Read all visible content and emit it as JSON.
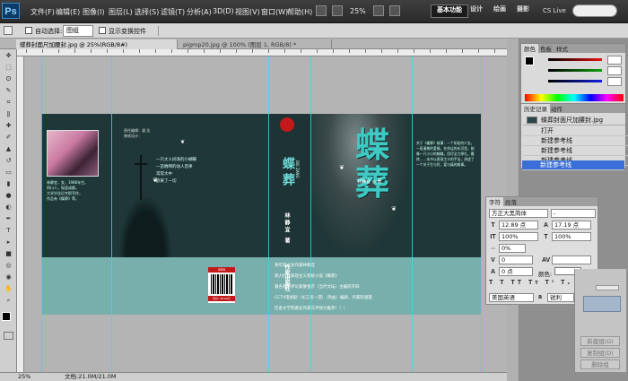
{
  "menubar": {
    "logo": "Ps",
    "items": [
      "文件(F)",
      "编辑(E)",
      "图像(I)",
      "图层(L)",
      "选择(S)",
      "滤镜(T)",
      "分析(A)",
      "3D(D)",
      "视图(V)",
      "窗口(W)",
      "帮助(H)"
    ],
    "zoom": "25%",
    "workspaces": [
      "基本功能",
      "设计",
      "绘画",
      "摄影"
    ],
    "cs_live": "CS Live"
  },
  "options_bar": {
    "auto_select_label": "自动选择:",
    "auto_select_value": "图组",
    "show_transform_label": "显示变换控件"
  },
  "tabs": [
    {
      "label": "蝶葬封面尺加腰封.jpg @ 25%(RGB/8#)",
      "active": true
    },
    {
      "label": "pigmp20.jpg @ 100% (图层 1, RGB/8) *",
      "active": false
    }
  ],
  "statusbar": {
    "zoom": "25%",
    "doc_info": "文档:21.0M/21.0M"
  },
  "cover": {
    "title_big": "蝶葬",
    "title_pinyin": "DIE ZANG",
    "back_top_text": "责任编辑：潘 浩\n装帧设计：",
    "back_author_label": "林静宜",
    "poem": "一只大人间泽的小蝴蝶\n一首缠绵的动人音律\n常常大中\n欲来了一切",
    "spine_author": "林静宜 著",
    "spine_publisher": "作家出版社",
    "front_author_tag": "林静宜 ◎ 著",
    "front_slogan": "青年鬼才女作家林静宜\n耗力打造表现主义系统小说《蝶葬》\n著名视剧评论家廖金京（当代文坛）主编何开四\nCCTV电视剧（长江第一漂）（热血）编剧，作家陈祖殷\n巴金文学院著名作家马平倾力推荐！！！",
    "barcode_label": "ISBN",
    "barcode_price": "定价: 28.00元",
    "back_flap_lines": "林静宜，女，1986年生。\n四川人，现居成都。\n大学毕业后专职写作，\n作品有《蝶葬》等。",
    "front_flap_text": "关于《蝶葬》故事：一个如花的少女，一段凄美的爱情。在命运的长河里，她像一只小小的蝴蝶，用尽全力挣扎，最终……本书以表现主义的手法，讲述了一个关于生与死、爱与痛的故事。"
  },
  "color_panel": {
    "tabs": [
      "颜色",
      "色板",
      "样式"
    ],
    "slider_colors": [
      "#e81010",
      "#10a010",
      "#1020e0"
    ]
  },
  "history_panel": {
    "tabs": [
      "历史记录",
      "动作"
    ],
    "snapshot": "蝶葬封面尺加腰封.jpg",
    "items": [
      "打开",
      "新建参考线",
      "新建参考线",
      "新建参考线",
      "新建参考线"
    ],
    "selected_index": 4
  },
  "char_panel": {
    "tabs": [
      "字符",
      "段落"
    ],
    "font": "方正大黑简体",
    "style": "-",
    "size": "12.89 点",
    "leading": "17.19 点",
    "vscale": "100%",
    "hscale": "100%",
    "tracking": "0%",
    "kerning": "0",
    "baseline": "0 点",
    "color_label": "颜色:",
    "language": "美国英语",
    "aa_label": "a",
    "aa": "锐利"
  },
  "layers_footer": {
    "buttons": [
      "新建组(G)",
      "复制组(D)",
      "删除组"
    ]
  },
  "colors": {
    "accent": "#3a6ed8",
    "cover_dark": "#1f3738",
    "cover_band": "#78afac",
    "title_cyan": "#3ec9c4"
  }
}
